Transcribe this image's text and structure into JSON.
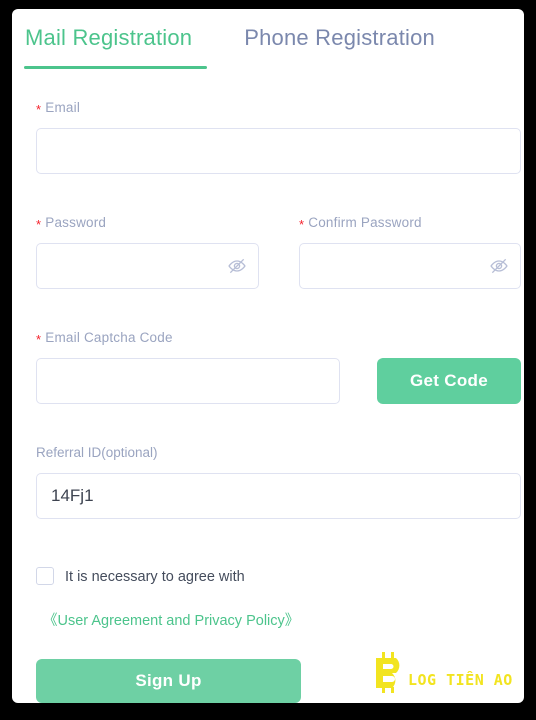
{
  "tabs": [
    {
      "id": "mail",
      "label": "Mail Registration",
      "active": true
    },
    {
      "id": "phone",
      "label": "Phone Registration",
      "active": false
    }
  ],
  "form": {
    "required_marker": "*",
    "email": {
      "label": "Email",
      "value": "",
      "placeholder": ""
    },
    "password": {
      "label": "Password",
      "value": "",
      "placeholder": "",
      "toggle_icon": "eye-slash-icon"
    },
    "confirm_password": {
      "label": "Confirm Password",
      "value": "",
      "placeholder": "",
      "toggle_icon": "eye-slash-icon"
    },
    "captcha": {
      "label": "Email Captcha Code",
      "value": "",
      "placeholder": "",
      "button_label": "Get Code"
    },
    "referral": {
      "label": "Referral ID(optional)",
      "value": "14Fj1",
      "placeholder": ""
    },
    "agreement": {
      "checked": false,
      "text": "It is necessary to agree with",
      "link_text": "《User Agreement and Privacy Policy》"
    },
    "submit_label": "Sign Up"
  },
  "watermark": {
    "symbol": "₿",
    "text": "LOG TIỀN ẢO",
    "full_text": "BLOG TIỀN ẢO"
  },
  "colors": {
    "accent_green": "#4cc48c",
    "button_green": "#5fcf9e",
    "signup_green": "#6ed0a4",
    "inactive_tab": "#7b88ad",
    "label_gray": "#9aa4c0",
    "required_red": "#f5222d",
    "input_border": "#dfe2f1",
    "watermark_yellow": "#f2e420",
    "frame_black": "#000000",
    "card_white": "#ffffff"
  }
}
